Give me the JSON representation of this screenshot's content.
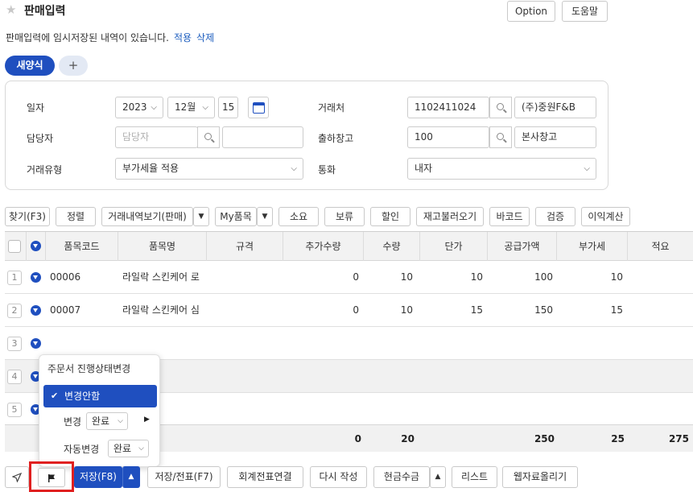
{
  "header": {
    "title": "판매입력",
    "option_label": "Option",
    "help_label": "도움말"
  },
  "notice": {
    "text": "판매입력에 임시저장된 내역이 있습니다.",
    "apply_label": "적용",
    "delete_label": "삭제"
  },
  "tabs": {
    "new_form_label": "새양식",
    "add_label": "+"
  },
  "form": {
    "date": {
      "label": "일자",
      "year": "2023",
      "month": "12월",
      "day": "15"
    },
    "customer": {
      "label": "거래처",
      "code": "1102411024",
      "name": "(주)중원F&B"
    },
    "manager": {
      "label": "담당자",
      "placeholder": "담당자",
      "value": ""
    },
    "warehouse": {
      "label": "출하창고",
      "code": "100",
      "name": "본사창고"
    },
    "trade_type": {
      "label": "거래유형",
      "value": "부가세율 적용"
    },
    "currency": {
      "label": "통화",
      "value": "내자"
    }
  },
  "toolbar": {
    "find": "찾기(F3)",
    "sort": "정렬",
    "history": "거래내역보기(판매)",
    "my_items": "My품목",
    "subtotal": "소요",
    "hold": "보류",
    "discount": "할인",
    "reload_stock": "재고불러오기",
    "barcode": "바코드",
    "verify": "검증",
    "profit": "이익계산"
  },
  "grid": {
    "columns": [
      "품목코드",
      "품목명",
      "규격",
      "추가수량",
      "수량",
      "단가",
      "공급가액",
      "부가세",
      "적요"
    ],
    "rows": [
      {
        "no": "1",
        "code": "00006",
        "name": "라일락 스킨케어 로",
        "spec": "",
        "extra_qty": "0",
        "qty": "10",
        "price": "10",
        "supply": "100",
        "vat": "10",
        "memo": ""
      },
      {
        "no": "2",
        "code": "00007",
        "name": "라일락 스킨케어 심",
        "spec": "",
        "extra_qty": "0",
        "qty": "10",
        "price": "15",
        "supply": "150",
        "vat": "15",
        "memo": ""
      },
      {
        "no": "3"
      },
      {
        "no": "4"
      },
      {
        "no": "5"
      }
    ],
    "totals": {
      "extra_qty": "0",
      "qty": "20",
      "supply": "250",
      "vat": "25",
      "total": "275"
    }
  },
  "popup": {
    "title": "주문서 진행상태변경",
    "selected": "변경안함",
    "change_label": "변경",
    "change_value": "완료",
    "auto_label": "자동변경",
    "auto_value": "완료"
  },
  "bottom": {
    "save": "저장(F8)",
    "save_slip": "저장/전표(F7)",
    "acct_link": "회계전표연결",
    "rewrite": "다시 작성",
    "cash": "현금수금",
    "list": "리스트",
    "web_upload": "웹자료올리기"
  },
  "colors": {
    "primary": "#1f4fbf",
    "highlight_border": "#e02020"
  }
}
